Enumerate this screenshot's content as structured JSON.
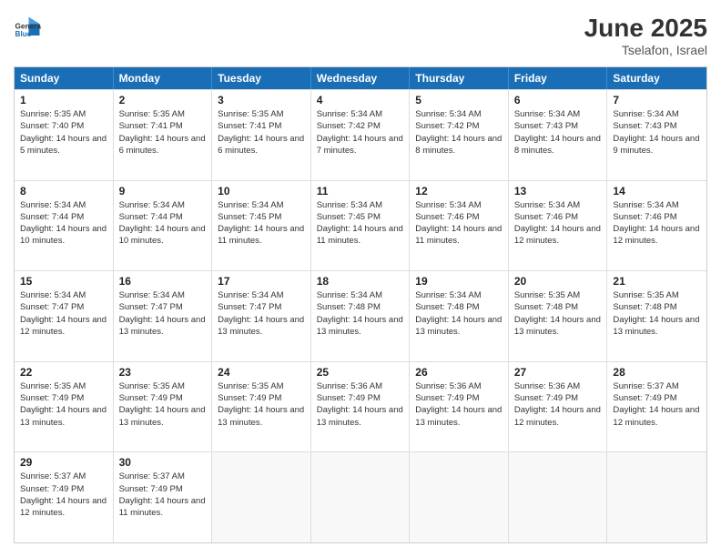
{
  "logo": {
    "general": "General",
    "blue": "Blue"
  },
  "title": "June 2025",
  "subtitle": "Tselafon, Israel",
  "days": [
    "Sunday",
    "Monday",
    "Tuesday",
    "Wednesday",
    "Thursday",
    "Friday",
    "Saturday"
  ],
  "weeks": [
    [
      {
        "day": 1,
        "sunrise": "5:35 AM",
        "sunset": "7:40 PM",
        "daylight": "14 hours and 5 minutes."
      },
      {
        "day": 2,
        "sunrise": "5:35 AM",
        "sunset": "7:41 PM",
        "daylight": "14 hours and 6 minutes."
      },
      {
        "day": 3,
        "sunrise": "5:35 AM",
        "sunset": "7:41 PM",
        "daylight": "14 hours and 6 minutes."
      },
      {
        "day": 4,
        "sunrise": "5:34 AM",
        "sunset": "7:42 PM",
        "daylight": "14 hours and 7 minutes."
      },
      {
        "day": 5,
        "sunrise": "5:34 AM",
        "sunset": "7:42 PM",
        "daylight": "14 hours and 8 minutes."
      },
      {
        "day": 6,
        "sunrise": "5:34 AM",
        "sunset": "7:43 PM",
        "daylight": "14 hours and 8 minutes."
      },
      {
        "day": 7,
        "sunrise": "5:34 AM",
        "sunset": "7:43 PM",
        "daylight": "14 hours and 9 minutes."
      }
    ],
    [
      {
        "day": 8,
        "sunrise": "5:34 AM",
        "sunset": "7:44 PM",
        "daylight": "14 hours and 10 minutes."
      },
      {
        "day": 9,
        "sunrise": "5:34 AM",
        "sunset": "7:44 PM",
        "daylight": "14 hours and 10 minutes."
      },
      {
        "day": 10,
        "sunrise": "5:34 AM",
        "sunset": "7:45 PM",
        "daylight": "14 hours and 11 minutes."
      },
      {
        "day": 11,
        "sunrise": "5:34 AM",
        "sunset": "7:45 PM",
        "daylight": "14 hours and 11 minutes."
      },
      {
        "day": 12,
        "sunrise": "5:34 AM",
        "sunset": "7:46 PM",
        "daylight": "14 hours and 11 minutes."
      },
      {
        "day": 13,
        "sunrise": "5:34 AM",
        "sunset": "7:46 PM",
        "daylight": "14 hours and 12 minutes."
      },
      {
        "day": 14,
        "sunrise": "5:34 AM",
        "sunset": "7:46 PM",
        "daylight": "14 hours and 12 minutes."
      }
    ],
    [
      {
        "day": 15,
        "sunrise": "5:34 AM",
        "sunset": "7:47 PM",
        "daylight": "14 hours and 12 minutes."
      },
      {
        "day": 16,
        "sunrise": "5:34 AM",
        "sunset": "7:47 PM",
        "daylight": "14 hours and 13 minutes."
      },
      {
        "day": 17,
        "sunrise": "5:34 AM",
        "sunset": "7:47 PM",
        "daylight": "14 hours and 13 minutes."
      },
      {
        "day": 18,
        "sunrise": "5:34 AM",
        "sunset": "7:48 PM",
        "daylight": "14 hours and 13 minutes."
      },
      {
        "day": 19,
        "sunrise": "5:34 AM",
        "sunset": "7:48 PM",
        "daylight": "14 hours and 13 minutes."
      },
      {
        "day": 20,
        "sunrise": "5:35 AM",
        "sunset": "7:48 PM",
        "daylight": "14 hours and 13 minutes."
      },
      {
        "day": 21,
        "sunrise": "5:35 AM",
        "sunset": "7:48 PM",
        "daylight": "14 hours and 13 minutes."
      }
    ],
    [
      {
        "day": 22,
        "sunrise": "5:35 AM",
        "sunset": "7:49 PM",
        "daylight": "14 hours and 13 minutes."
      },
      {
        "day": 23,
        "sunrise": "5:35 AM",
        "sunset": "7:49 PM",
        "daylight": "14 hours and 13 minutes."
      },
      {
        "day": 24,
        "sunrise": "5:35 AM",
        "sunset": "7:49 PM",
        "daylight": "14 hours and 13 minutes."
      },
      {
        "day": 25,
        "sunrise": "5:36 AM",
        "sunset": "7:49 PM",
        "daylight": "14 hours and 13 minutes."
      },
      {
        "day": 26,
        "sunrise": "5:36 AM",
        "sunset": "7:49 PM",
        "daylight": "14 hours and 13 minutes."
      },
      {
        "day": 27,
        "sunrise": "5:36 AM",
        "sunset": "7:49 PM",
        "daylight": "14 hours and 12 minutes."
      },
      {
        "day": 28,
        "sunrise": "5:37 AM",
        "sunset": "7:49 PM",
        "daylight": "14 hours and 12 minutes."
      }
    ],
    [
      {
        "day": 29,
        "sunrise": "5:37 AM",
        "sunset": "7:49 PM",
        "daylight": "14 hours and 12 minutes."
      },
      {
        "day": 30,
        "sunrise": "5:37 AM",
        "sunset": "7:49 PM",
        "daylight": "14 hours and 11 minutes."
      },
      null,
      null,
      null,
      null,
      null
    ]
  ]
}
